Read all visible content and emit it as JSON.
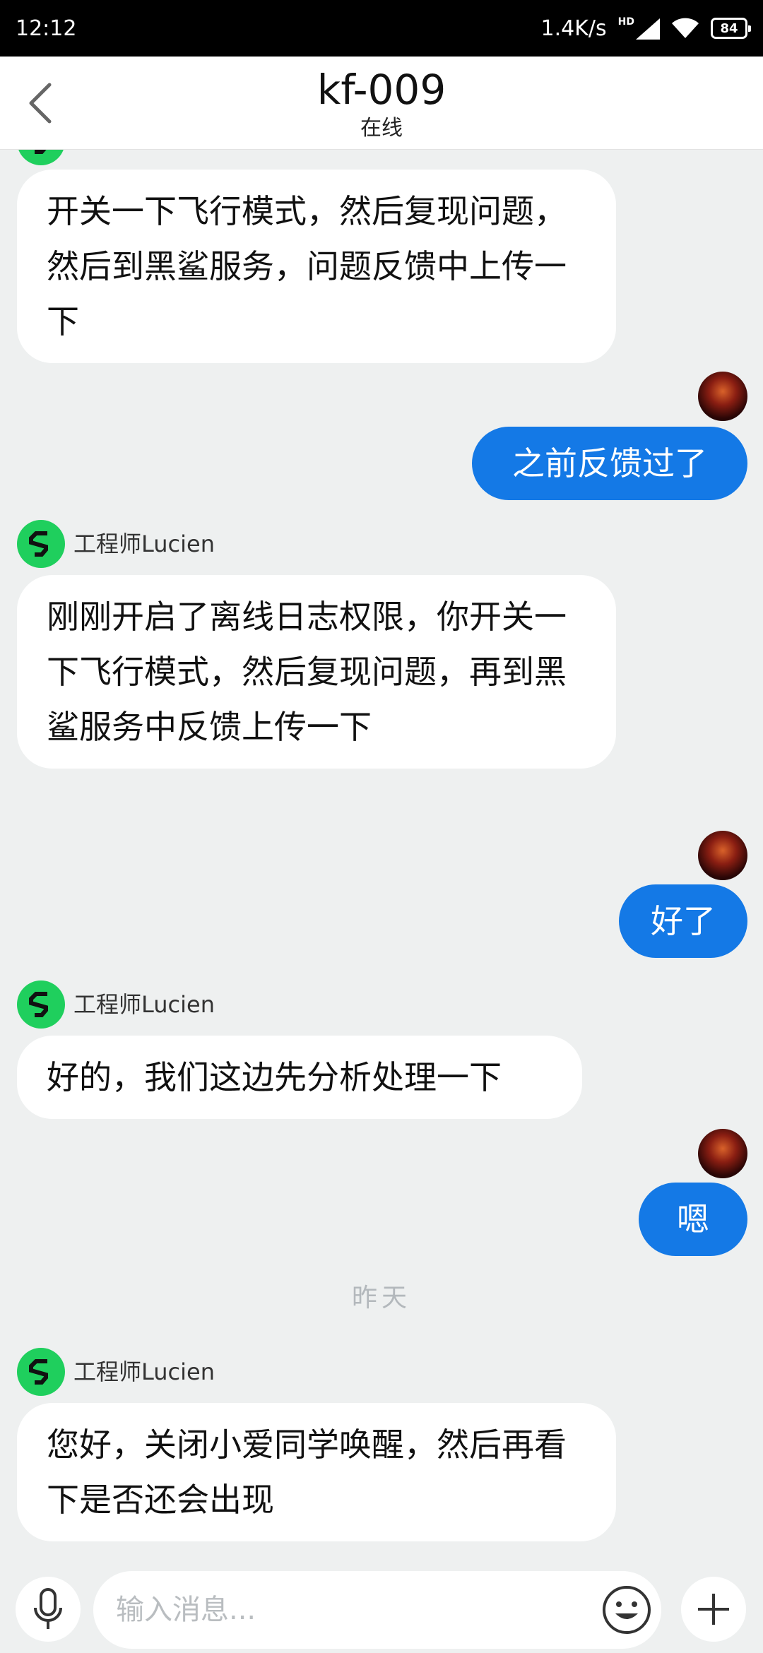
{
  "status_bar": {
    "time": "12:12",
    "net_speed": "1.4K/s",
    "hd": "HD",
    "battery": "84"
  },
  "header": {
    "title": "kf-009",
    "subtitle": "在线"
  },
  "chat": {
    "messages": [
      {
        "side": "left",
        "text": "开关一下飞行模式，然后复现问题，然后到黑鲨服务，问题反馈中上传一下"
      },
      {
        "side": "right",
        "text": "之前反馈过了"
      },
      {
        "side": "left",
        "sender": "工程师Lucien",
        "text": "刚刚开启了离线日志权限，你开关一下飞行模式，然后复现问题，再到黑鲨服务中反馈上传一下"
      },
      {
        "side": "right",
        "text": "好了"
      },
      {
        "side": "left",
        "sender": "工程师Lucien",
        "text": "好的，我们这边先分析处理一下"
      },
      {
        "side": "right",
        "text": "嗯"
      },
      {
        "side": "left",
        "sender": "工程师Lucien",
        "text": "您好，关闭小爱同学唤醒，然后再看下是否还会出现"
      }
    ],
    "date_divider": "昨天"
  },
  "input": {
    "placeholder": "输入消息..."
  },
  "icons": {
    "back": "chevron-left-icon",
    "wifi": "wifi-icon",
    "signal": "signal-icon",
    "battery": "battery-icon",
    "agent_avatar": "black-shark-logo-icon",
    "mic": "microphone-icon",
    "emoji": "emoji-icon",
    "plus": "plus-icon"
  },
  "colors": {
    "accent": "#1479e6",
    "agent_avatar": "#1fcf5d",
    "background": "#eef0f0"
  }
}
